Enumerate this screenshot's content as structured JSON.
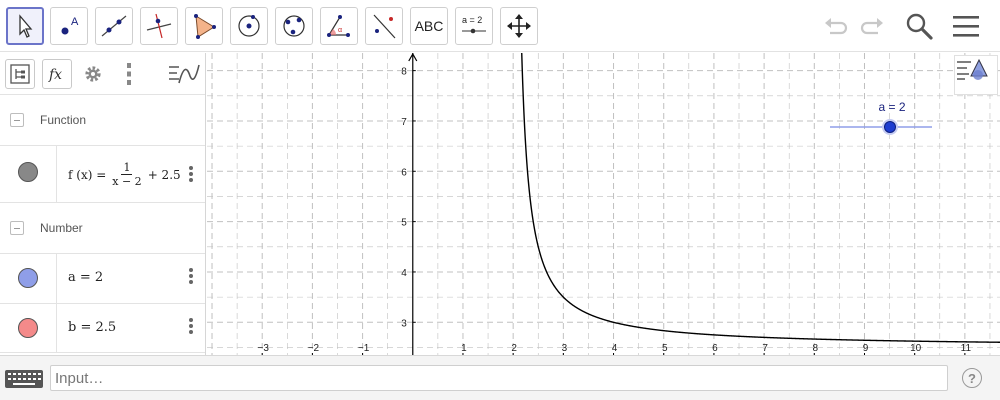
{
  "toolbar": {
    "tools": [
      {
        "name": "move-tool",
        "selected": true
      },
      {
        "name": "point-tool",
        "label": "A"
      },
      {
        "name": "line-tool"
      },
      {
        "name": "perpendicular-line-tool"
      },
      {
        "name": "polygon-tool"
      },
      {
        "name": "circle-center-point-tool"
      },
      {
        "name": "circle-three-points-tool"
      },
      {
        "name": "angle-tool",
        "label": "α"
      },
      {
        "name": "reflect-tool"
      },
      {
        "name": "text-tool",
        "label": "ABC"
      },
      {
        "name": "slider-tool",
        "label": "a = 2"
      },
      {
        "name": "move-graphics-view-tool"
      }
    ]
  },
  "algebra": {
    "groups": [
      {
        "label": "Function"
      },
      {
        "label": "Number"
      }
    ],
    "function_row": {
      "lhs": "f (x)  =",
      "numerator": "1",
      "denominator": "x − 2",
      "tail": "+ 2.5",
      "color": "#888888"
    },
    "number_rows": [
      {
        "text": "a  =  2",
        "color": "#8f9ee8"
      },
      {
        "text": "b  =  2.5",
        "color": "#f48a8a"
      }
    ]
  },
  "graphics": {
    "slider_label": "a = 2",
    "axis_color": "#000000",
    "grid_color": "#c0c0c0",
    "curve_color": "#000000",
    "x_ticks": [
      -3,
      -2,
      -1,
      1,
      2,
      3,
      4,
      5,
      6,
      7,
      8,
      9,
      10,
      11
    ],
    "y_ticks": [
      3,
      4,
      5,
      6,
      7,
      8
    ]
  },
  "chart_data": {
    "type": "line",
    "title": "",
    "xlabel": "",
    "ylabel": "",
    "xlim": [
      -4.1,
      11.7
    ],
    "ylim": [
      2.35,
      8.35
    ],
    "series": [
      {
        "function": "1/(x-2)+2.5",
        "x": [
          2.15,
          2.2,
          2.25,
          2.3,
          2.4,
          2.5,
          2.75,
          3,
          3.5,
          4,
          5,
          6,
          7,
          8,
          9,
          10,
          11,
          11.7
        ],
        "values": [
          9.17,
          7.5,
          6.5,
          5.83,
          5,
          4.5,
          3.83,
          3.5,
          3.17,
          3,
          2.83,
          2.75,
          2.7,
          2.67,
          2.64,
          2.63,
          2.61,
          2.6
        ]
      }
    ],
    "slider": {
      "name": "a",
      "value": 2
    }
  }
}
